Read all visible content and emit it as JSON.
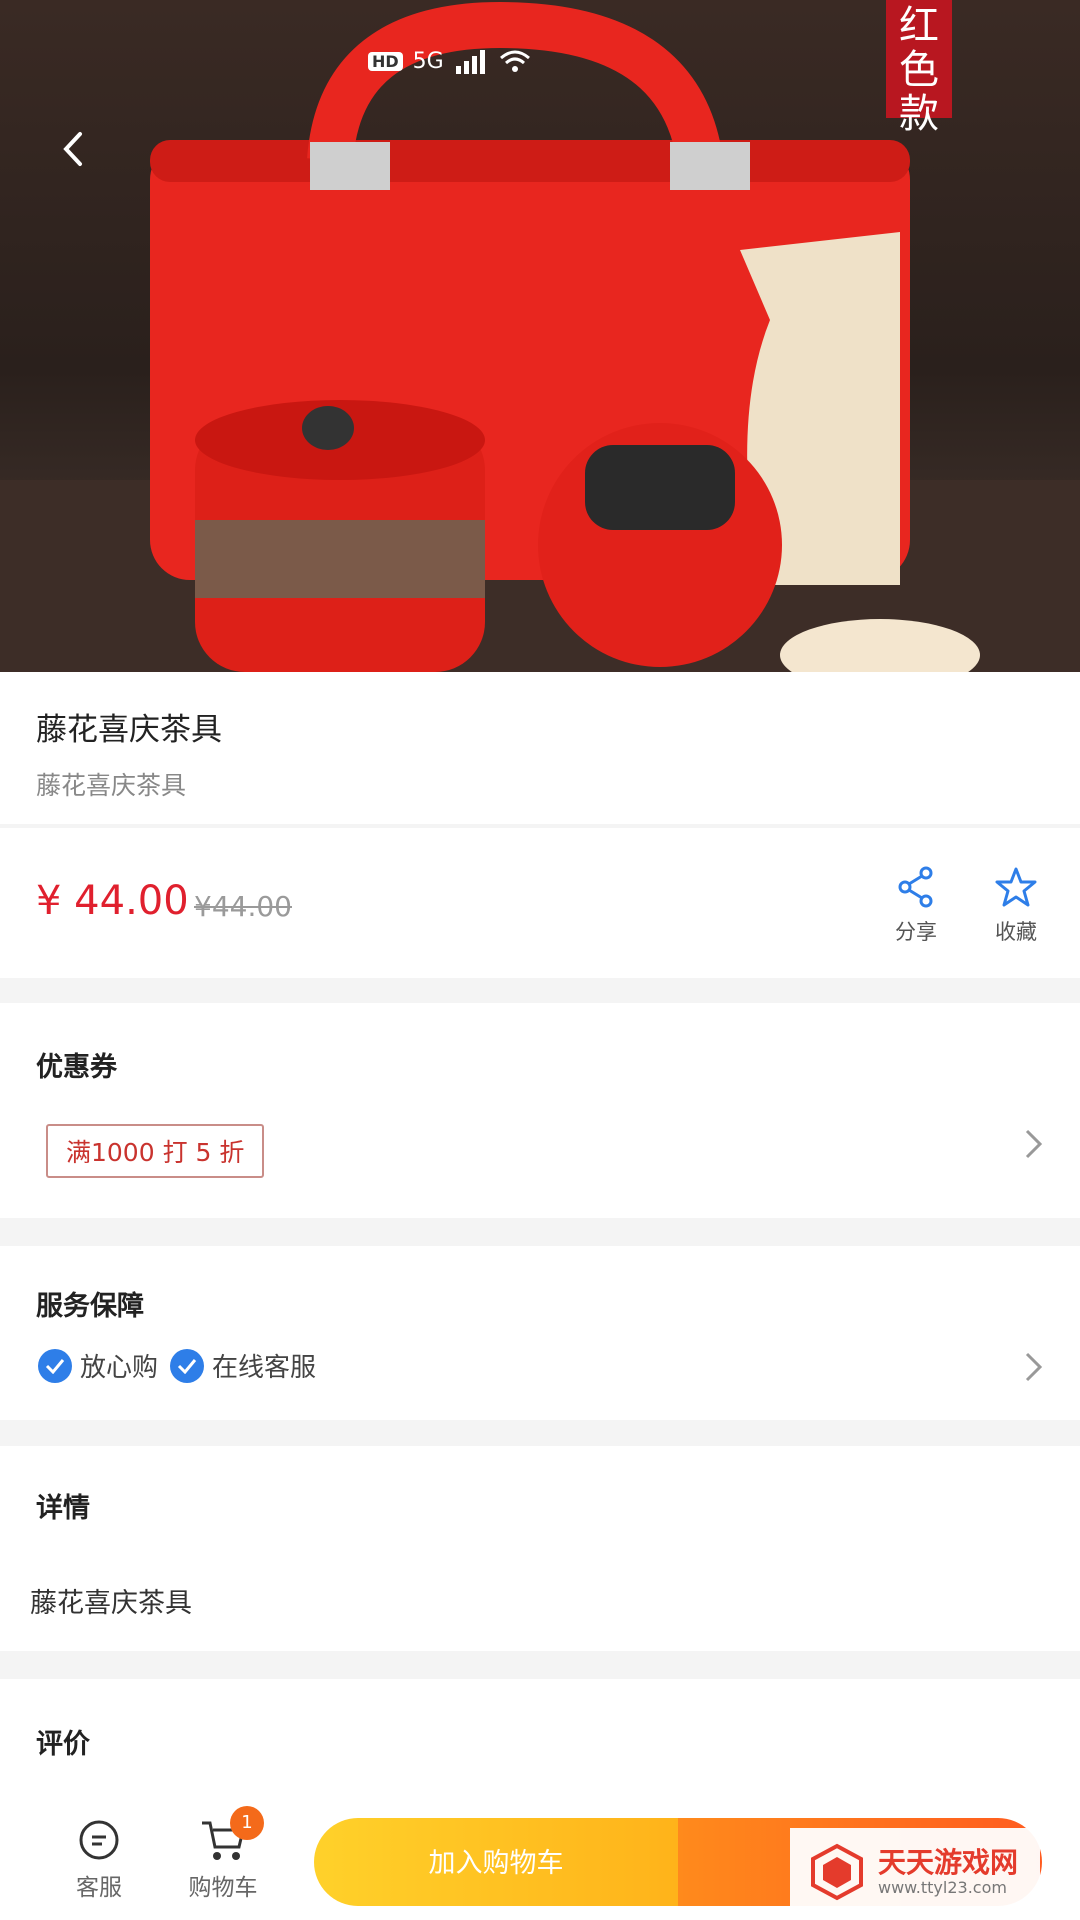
{
  "status_bar": {
    "network": "HD",
    "signal": "5G"
  },
  "product_image": {
    "badge_text": "红色款"
  },
  "product": {
    "title": "藤花喜庆茶具",
    "subtitle": "藤花喜庆茶具",
    "price": "¥ 44.00",
    "original_price": "¥44.00"
  },
  "actions": {
    "share": "分享",
    "favorite": "收藏"
  },
  "coupon": {
    "title": "优惠券",
    "tag": "满1000 打 5 折"
  },
  "service": {
    "title": "服务保障",
    "items": [
      "放心购",
      "在线客服"
    ]
  },
  "detail": {
    "title": "详情",
    "text": "藤花喜庆茶具"
  },
  "reviews": {
    "title": "评价"
  },
  "bottom_nav": {
    "service": "客服",
    "cart": "购物车",
    "cart_count": "1",
    "add_to_cart": "加入购物车"
  },
  "watermark": {
    "name": "天天游戏网",
    "url": "www.ttyl23.com"
  },
  "colors": {
    "price_red": "#e0202e",
    "service_blue": "#2e7ee8",
    "cart_yellow": "#ffc21f",
    "buy_orange": "#ff6a1f"
  }
}
